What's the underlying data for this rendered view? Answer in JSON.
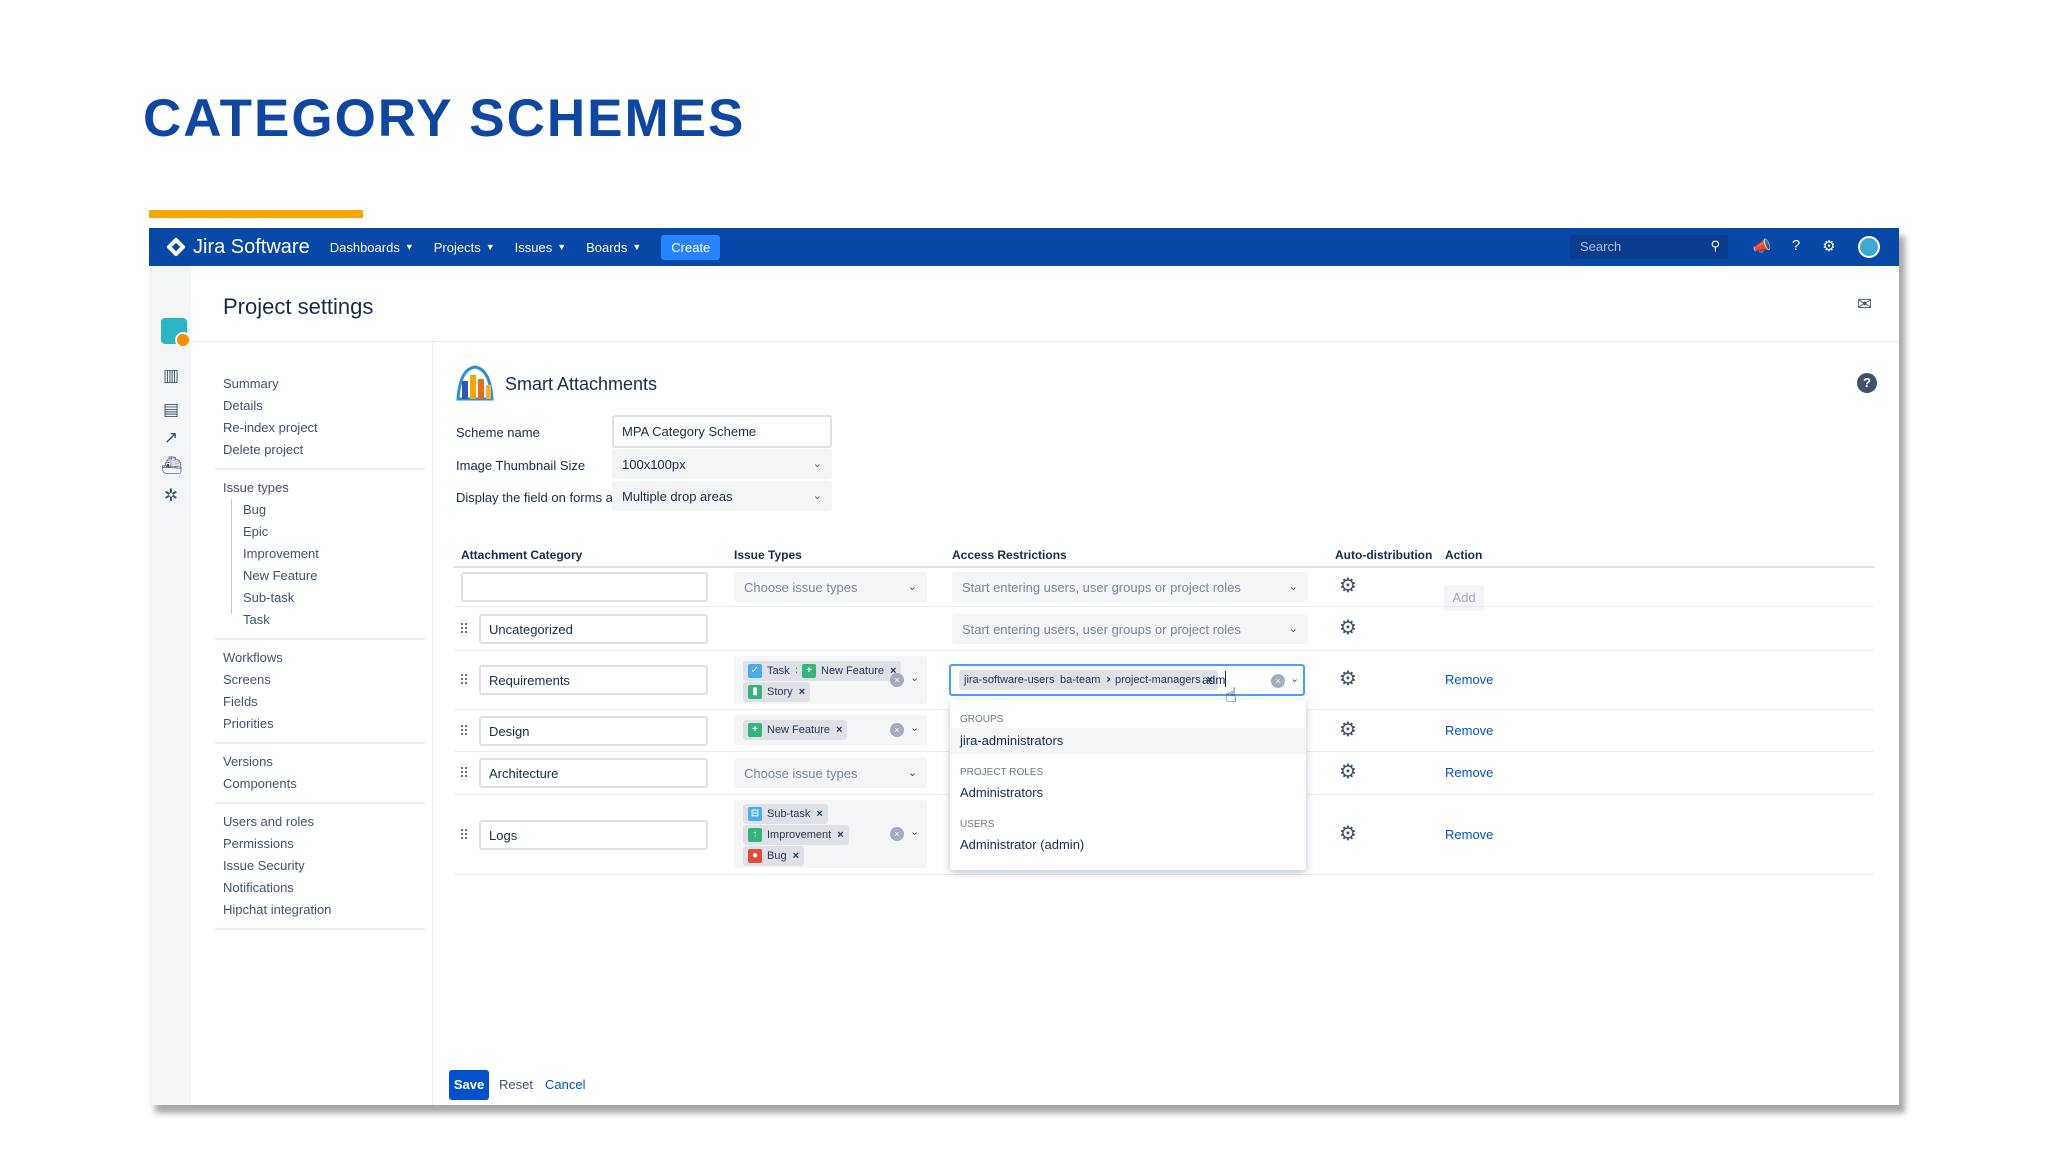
{
  "slide": {
    "title": "CATEGORY SCHEMES"
  },
  "nav": {
    "product": "Jira Software",
    "items": [
      "Dashboards",
      "Projects",
      "Issues",
      "Boards"
    ],
    "create": "Create",
    "search_placeholder": "Search"
  },
  "page": {
    "title": "Project settings"
  },
  "menu": {
    "group1": [
      "Summary",
      "Details",
      "Re-index project",
      "Delete project"
    ],
    "issue_types_label": "Issue types",
    "issue_types": [
      "Bug",
      "Epic",
      "Improvement",
      "New Feature",
      "Sub-task",
      "Task"
    ],
    "group3": [
      "Workflows",
      "Screens",
      "Fields",
      "Priorities"
    ],
    "group4": [
      "Versions",
      "Components"
    ],
    "group5": [
      "Users and roles",
      "Permissions",
      "Issue Security",
      "Notifications",
      "Hipchat integration"
    ]
  },
  "plugin": {
    "title": "Smart Attachments"
  },
  "form": {
    "scheme_name_label": "Scheme name",
    "scheme_name_value": "MPA Category Scheme",
    "thumb_label": "Image Thumbnail Size",
    "thumb_value": "100x100px",
    "display_label": "Display the field on forms as",
    "display_value": "Multiple drop areas"
  },
  "table": {
    "headers": [
      "Attachment Category",
      "Issue Types",
      "Access Restrictions",
      "Auto-distribution",
      "Action"
    ],
    "issue_placeholder": "Choose issue types",
    "access_placeholder": "Start entering users, user groups or project roles",
    "add": "Add",
    "remove": "Remove",
    "rows": [
      {
        "category": "Uncategorized"
      },
      {
        "category": "Requirements",
        "issue_types": [
          "Task",
          "New Feature",
          "Story"
        ],
        "access": [
          "jira-software-users",
          "ba-team",
          "project-managers"
        ],
        "typed": "adm"
      },
      {
        "category": "Design",
        "issue_types": [
          "New Feature"
        ]
      },
      {
        "category": "Architecture"
      },
      {
        "category": "Logs",
        "issue_types": [
          "Sub-task",
          "Improvement",
          "Bug"
        ]
      }
    ]
  },
  "dropdown": {
    "groups_label": "GROUPS",
    "groups_opt": "jira-administrators",
    "roles_label": "PROJECT ROLES",
    "roles_opt": "Administrators",
    "users_label": "USERS",
    "users_opt": "Administrator (admin)"
  },
  "buttons": {
    "save": "Save",
    "reset": "Reset",
    "cancel": "Cancel"
  },
  "colors": {
    "nav_bg": "#0747a6",
    "title_blue": "#0e47a1",
    "accent": "#f7a600",
    "primary": "#0052cc"
  }
}
